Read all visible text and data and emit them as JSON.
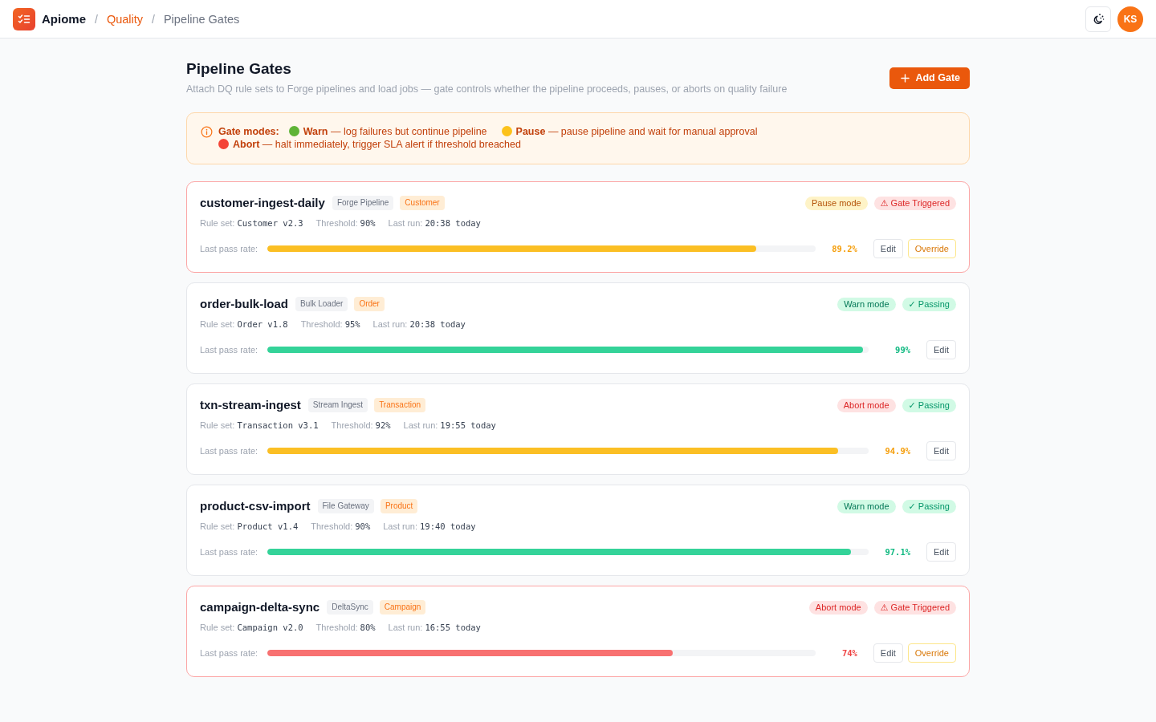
{
  "header": {
    "brand": "Apiome",
    "breadcrumb": [
      {
        "separator": "/",
        "label": "Quality",
        "kind": "link"
      },
      {
        "separator": "/",
        "label": "Pipeline Gates",
        "kind": "current"
      }
    ],
    "avatar": {
      "initials": "KS"
    }
  },
  "page": {
    "title": "Pipeline Gates",
    "subtitle": "Attach DQ rule sets to Forge pipelines and load jobs — gate controls whether the pipeline proceeds, pauses, or aborts on quality failure",
    "add_button": {
      "label": "Add Gate"
    }
  },
  "gate_modes_notice": {
    "label": "Gate modes:",
    "modes": [
      {
        "color": "#5fb336",
        "text": "**Warn** — log failures but continue pipeline"
      },
      {
        "color": "#fcc21b",
        "text": "**Pause** — pause pipeline and wait for manual approval"
      },
      {
        "color": "#f44336",
        "text": "**Abort** — halt immediately, trigger SLA alert if threshold breached"
      }
    ]
  },
  "gates": [
    {
      "name": "customer-ingest-daily",
      "tags": [
        {
          "label": "Forge Pipeline",
          "kind": "source"
        },
        {
          "label": "Customer",
          "kind": "domain"
        }
      ],
      "mode": {
        "label": "Pause mode",
        "kind": "pause"
      },
      "status": {
        "label": "⚠ Gate Triggered",
        "kind": "triggered"
      },
      "meta": [
        {
          "label": "Rule set:",
          "value": "Customer v2.3"
        },
        {
          "label": "Threshold:",
          "value": "90%"
        },
        {
          "label": "Last run:",
          "value": "20:38 today"
        }
      ],
      "pass_rate": {
        "label": "Last pass rate:",
        "level": 0.892,
        "reading": "89.2%",
        "kind": "fair"
      },
      "actions": [
        {
          "label": "Edit",
          "kind": "edit"
        },
        {
          "label": "Override",
          "kind": "override"
        }
      ]
    },
    {
      "name": "order-bulk-load",
      "tags": [
        {
          "label": "Bulk Loader",
          "kind": "source"
        },
        {
          "label": "Order",
          "kind": "domain"
        }
      ],
      "mode": {
        "label": "Warn mode",
        "kind": "warn"
      },
      "status": {
        "label": "✓ Passing",
        "kind": "passing"
      },
      "meta": [
        {
          "label": "Rule set:",
          "value": "Order v1.8"
        },
        {
          "label": "Threshold:",
          "value": "95%"
        },
        {
          "label": "Last run:",
          "value": "20:38 today"
        }
      ],
      "pass_rate": {
        "label": "Last pass rate:",
        "level": 0.99,
        "reading": "99%",
        "kind": "good"
      },
      "actions": [
        {
          "label": "Edit",
          "kind": "edit"
        }
      ]
    },
    {
      "name": "txn-stream-ingest",
      "tags": [
        {
          "label": "Stream Ingest",
          "kind": "source"
        },
        {
          "label": "Transaction",
          "kind": "domain"
        }
      ],
      "mode": {
        "label": "Abort mode",
        "kind": "abort"
      },
      "status": {
        "label": "✓ Passing",
        "kind": "passing"
      },
      "meta": [
        {
          "label": "Rule set:",
          "value": "Transaction v3.1"
        },
        {
          "label": "Threshold:",
          "value": "92%"
        },
        {
          "label": "Last run:",
          "value": "19:55 today"
        }
      ],
      "pass_rate": {
        "label": "Last pass rate:",
        "level": 0.949,
        "reading": "94.9%",
        "kind": "fair"
      },
      "actions": [
        {
          "label": "Edit",
          "kind": "edit"
        }
      ]
    },
    {
      "name": "product-csv-import",
      "tags": [
        {
          "label": "File Gateway",
          "kind": "source"
        },
        {
          "label": "Product",
          "kind": "domain"
        }
      ],
      "mode": {
        "label": "Warn mode",
        "kind": "warn"
      },
      "status": {
        "label": "✓ Passing",
        "kind": "passing"
      },
      "meta": [
        {
          "label": "Rule set:",
          "value": "Product v1.4"
        },
        {
          "label": "Threshold:",
          "value": "90%"
        },
        {
          "label": "Last run:",
          "value": "19:40 today"
        }
      ],
      "pass_rate": {
        "label": "Last pass rate:",
        "level": 0.971,
        "reading": "97.1%",
        "kind": "good"
      },
      "actions": [
        {
          "label": "Edit",
          "kind": "edit"
        }
      ]
    },
    {
      "name": "campaign-delta-sync",
      "tags": [
        {
          "label": "DeltaSync",
          "kind": "source"
        },
        {
          "label": "Campaign",
          "kind": "domain"
        }
      ],
      "mode": {
        "label": "Abort mode",
        "kind": "abort"
      },
      "status": {
        "label": "⚠ Gate Triggered",
        "kind": "triggered"
      },
      "meta": [
        {
          "label": "Rule set:",
          "value": "Campaign v2.0"
        },
        {
          "label": "Threshold:",
          "value": "80%"
        },
        {
          "label": "Last run:",
          "value": "16:55 today"
        }
      ],
      "pass_rate": {
        "label": "Last pass rate:",
        "level": 0.74,
        "reading": "74%",
        "kind": "poor"
      },
      "actions": [
        {
          "label": "Edit",
          "kind": "edit"
        },
        {
          "label": "Override",
          "kind": "override"
        }
      ]
    }
  ]
}
